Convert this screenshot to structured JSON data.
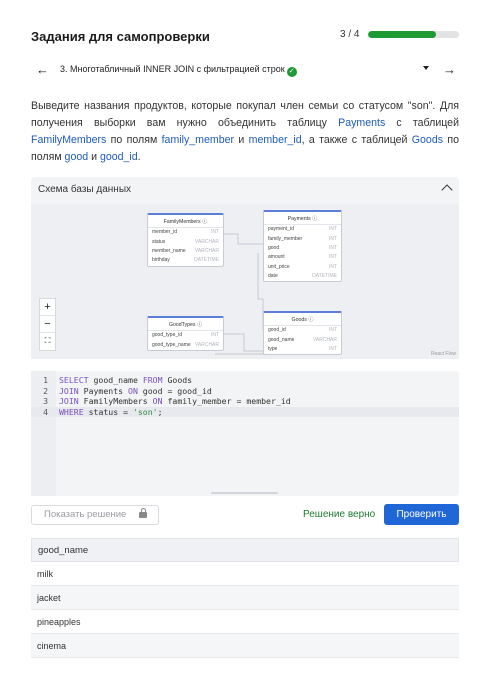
{
  "header": {
    "title": "Задания для самопроверки",
    "progress_text": "3 / 4",
    "progress_value": 0.75
  },
  "task": {
    "title": "3. Многотабличный INNER JOIN с фильтрацией строк",
    "status_icon": "check-circle-icon",
    "prev_icon": "arrow-left-icon",
    "next_icon": "arrow-right-icon",
    "dropdown_icon": "caret-down-icon"
  },
  "description": {
    "p1": "Выведите названия продуктов, которые покупал член семьи со статусом \"son\". Для получения выборки вам нужно объединить таблицу ",
    "t_payments": "Payments",
    "p2": " с таблицей ",
    "t_family": "FamilyMembers",
    "p3": " по полям ",
    "f_family_member": "family_member",
    "p4": " и ",
    "f_member_id": "member_id",
    "p5": ", а также с таблицей ",
    "t_goods": "Goods",
    "p6": " по полям ",
    "f_good": "good",
    "p7": " и ",
    "f_good_id": "good_id",
    "p8": "."
  },
  "schema": {
    "label": "Схема базы данных",
    "reactflow_credit": "React Flow",
    "zoom_in": "+",
    "zoom_out": "−",
    "fit_view": "⛶",
    "tables": {
      "family": {
        "name": "FamilyMembers",
        "fields": [
          {
            "name": "member_id",
            "type": "INT"
          },
          {
            "name": "status",
            "type": "VARCHAR"
          },
          {
            "name": "member_name",
            "type": "VARCHAR"
          },
          {
            "name": "birthday",
            "type": "DATETIME"
          }
        ]
      },
      "payments": {
        "name": "Payments",
        "fields": [
          {
            "name": "payment_id",
            "type": "INT"
          },
          {
            "name": "family_member",
            "type": "INT"
          },
          {
            "name": "good",
            "type": "INT"
          },
          {
            "name": "amount",
            "type": "INT"
          },
          {
            "name": "unit_price",
            "type": "INT"
          },
          {
            "name": "date",
            "type": "DATETIME"
          }
        ]
      },
      "goodtypes": {
        "name": "GoodTypes",
        "fields": [
          {
            "name": "good_type_id",
            "type": "INT"
          },
          {
            "name": "good_type_name",
            "type": "VARCHAR"
          }
        ]
      },
      "goods": {
        "name": "Goods",
        "fields": [
          {
            "name": "good_id",
            "type": "INT"
          },
          {
            "name": "good_name",
            "type": "VARCHAR"
          },
          {
            "name": "type",
            "type": "INT"
          }
        ]
      }
    }
  },
  "editor": {
    "lines": [
      {
        "num": "1",
        "parts": [
          {
            "t": "SELECT",
            "k": "kw"
          },
          {
            "t": " good_name ",
            "k": ""
          },
          {
            "t": "FROM",
            "k": "kw"
          },
          {
            "t": " Goods",
            "k": ""
          }
        ]
      },
      {
        "num": "2",
        "parts": [
          {
            "t": "JOIN",
            "k": "kw"
          },
          {
            "t": " Payments ",
            "k": ""
          },
          {
            "t": "ON",
            "k": "kw"
          },
          {
            "t": " good = good_id",
            "k": ""
          }
        ]
      },
      {
        "num": "3",
        "parts": [
          {
            "t": "JOIN",
            "k": "kw"
          },
          {
            "t": " FamilyMembers ",
            "k": ""
          },
          {
            "t": "ON",
            "k": "kw"
          },
          {
            "t": " family_member = member_id",
            "k": ""
          }
        ]
      },
      {
        "num": "4",
        "parts": [
          {
            "t": "WHERE",
            "k": "kw"
          },
          {
            "t": " status = ",
            "k": ""
          },
          {
            "t": "'son'",
            "k": "str"
          },
          {
            "t": ";",
            "k": ""
          }
        ]
      }
    ],
    "active_line": 4
  },
  "actions": {
    "show_solution": "Показать решение",
    "show_solution_icon": "lock-icon",
    "result_status": "Решение верно",
    "check_button": "Проверить"
  },
  "results": {
    "column": "good_name",
    "rows": [
      "milk",
      "jacket",
      "pineapples",
      "cinema"
    ]
  },
  "colors": {
    "accent": "#1f66d6",
    "success": "#1e9a34",
    "keyword": "#1e5bb8"
  }
}
